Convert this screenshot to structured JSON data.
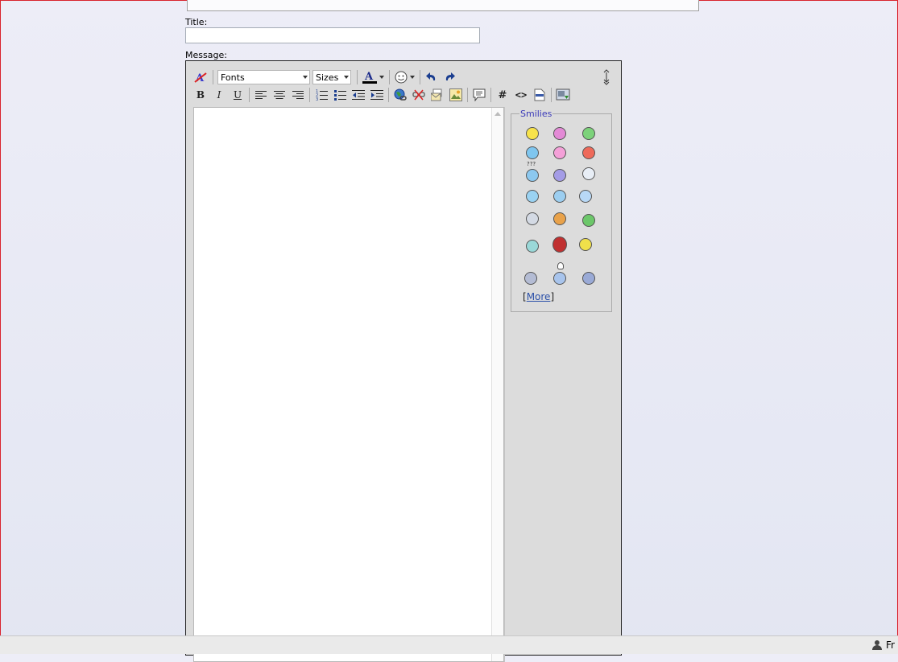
{
  "form": {
    "title_label": "Title:",
    "title_value": "",
    "message_label": "Message:"
  },
  "toolbar": {
    "fonts_value": "Fonts",
    "sizes_value": "Sizes",
    "bold_label": "B",
    "italic_label": "I",
    "underline_label": "U",
    "hash_label": "#",
    "code_label": "<>"
  },
  "smilies": {
    "legend": "Smilies",
    "more_link": "More",
    "question_caption": "???"
  },
  "taskbar": {
    "user_text": "Fr"
  },
  "colors": {
    "frame_border": "#d9242e",
    "link": "#2a4fa8",
    "legend": "#3a3ab8",
    "editor_bg": "#dcdcdc"
  }
}
